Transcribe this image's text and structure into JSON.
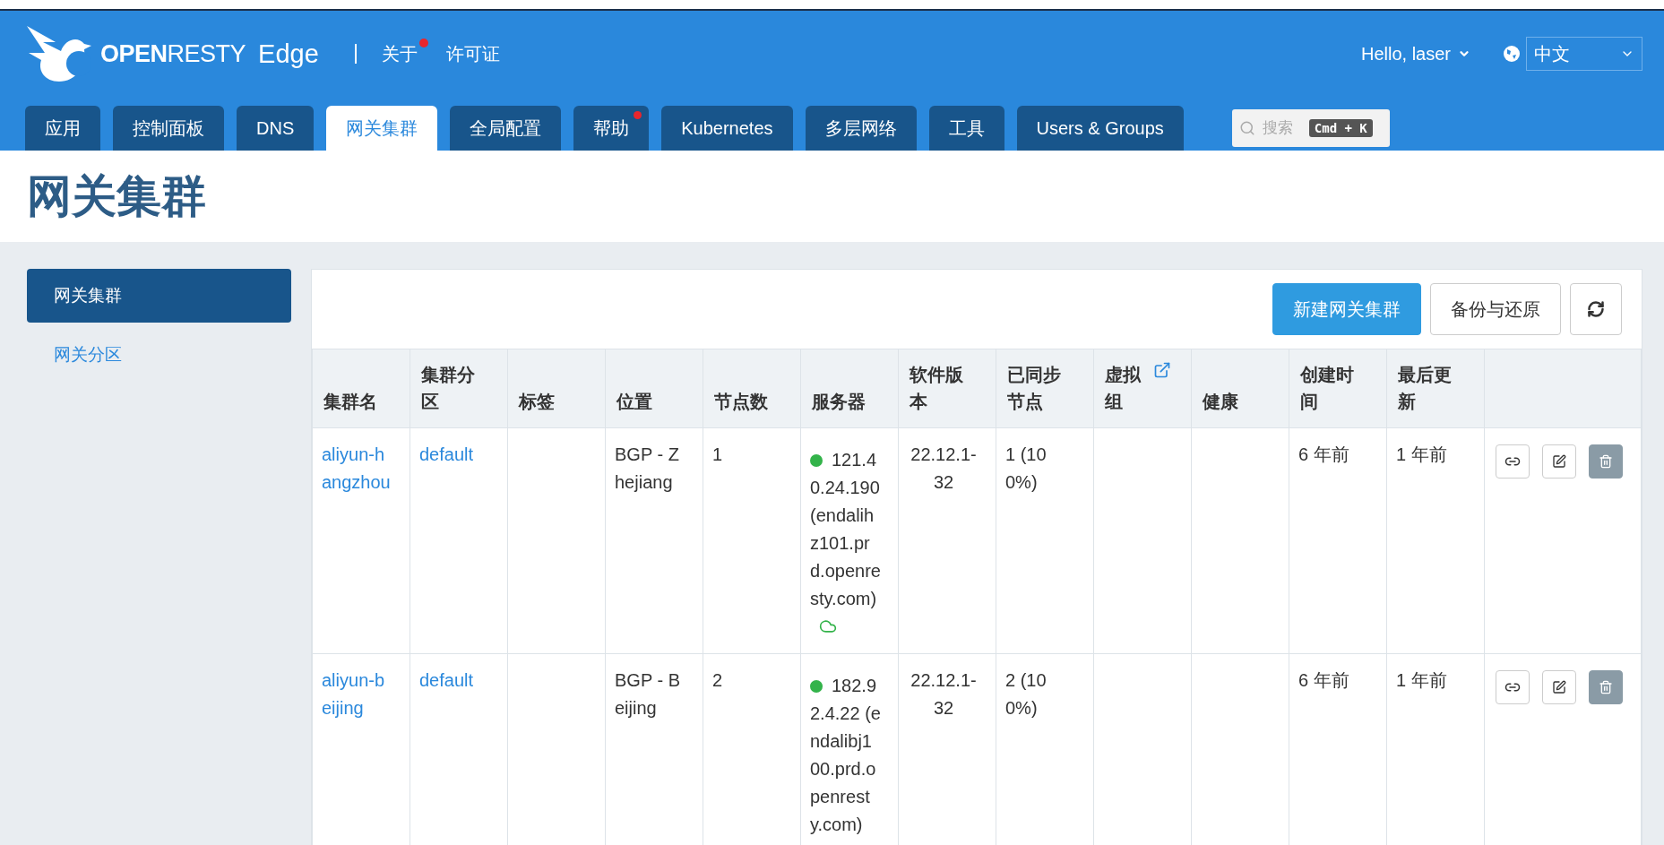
{
  "header": {
    "logo": "**OPEN**RESTY",
    "product": "Edge",
    "links": [
      {
        "label": "关于",
        "dot": true
      },
      {
        "label": "许可证",
        "dot": false
      }
    ],
    "user": "Hello, laser",
    "language": "中文"
  },
  "tabs": [
    {
      "label": "应用",
      "selected": false,
      "dot": false
    },
    {
      "label": "控制面板",
      "selected": false,
      "dot": false
    },
    {
      "label": "DNS",
      "selected": false,
      "dot": false
    },
    {
      "label": "网关集群",
      "selected": true,
      "dot": false
    },
    {
      "label": "全局配置",
      "selected": false,
      "dot": false
    },
    {
      "label": "帮助",
      "selected": false,
      "dot": true
    },
    {
      "label": "Kubernetes",
      "selected": false,
      "dot": false
    },
    {
      "label": "多层网络",
      "selected": false,
      "dot": false
    },
    {
      "label": "工具",
      "selected": false,
      "dot": false
    },
    {
      "label": "Users & Groups",
      "selected": false,
      "dot": false
    }
  ],
  "search": {
    "placeholder": "搜索",
    "shortcut": "Cmd + K"
  },
  "page_title": "网关集群",
  "sidebar": {
    "items": [
      {
        "label": "网关集群",
        "selected": true
      },
      {
        "label": "网关分区",
        "selected": false
      }
    ]
  },
  "toolbar": {
    "buttons": [
      {
        "kind": "primary",
        "label": "新建网关集群"
      },
      {
        "kind": "default",
        "label": "备份与还原"
      },
      {
        "kind": "refresh"
      }
    ]
  },
  "table": {
    "columns": [
      {
        "label": "集群名",
        "link_icon": false
      },
      {
        "label": "集群分区",
        "link_icon": false
      },
      {
        "label": "标签",
        "link_icon": false
      },
      {
        "label": "位置",
        "link_icon": false
      },
      {
        "label": "节点数",
        "link_icon": false
      },
      {
        "label": "服务器",
        "link_icon": false
      },
      {
        "label": "软件版本",
        "link_icon": false
      },
      {
        "label": "已同步节点",
        "link_icon": false
      },
      {
        "label": "虚拟组",
        "link_icon": true
      },
      {
        "label": "健康",
        "link_icon": false
      },
      {
        "label": "创建时间",
        "link_icon": false
      },
      {
        "label": "最后更新",
        "link_icon": false
      }
    ],
    "rows": [
      {
        "name": "aliyun-hangzhou",
        "partition": "default",
        "location": "BGP - Zhejiang",
        "nodes": "1",
        "server": {
          "color": "#33b34a",
          "text": "121.40.24.190 (endalihz101.prd.openresty.com)",
          "cloud_icon": true
        },
        "version": "22.12.1-32",
        "synced": "1 (100%)",
        "created": "6 年前",
        "updated": "1 年前"
      },
      {
        "name": "aliyun-beijing",
        "partition": "default",
        "location": "BGP - Beijing",
        "nodes": "2",
        "server": {
          "color": "#33b34a",
          "text": "182.92.4.22 (endalibj100.prd.openresty.com)",
          "cloud_icon": false
        },
        "version": "22.12.1-32",
        "synced": "2 (100%)",
        "created": "6 年前",
        "updated": "1 年前"
      }
    ]
  }
}
